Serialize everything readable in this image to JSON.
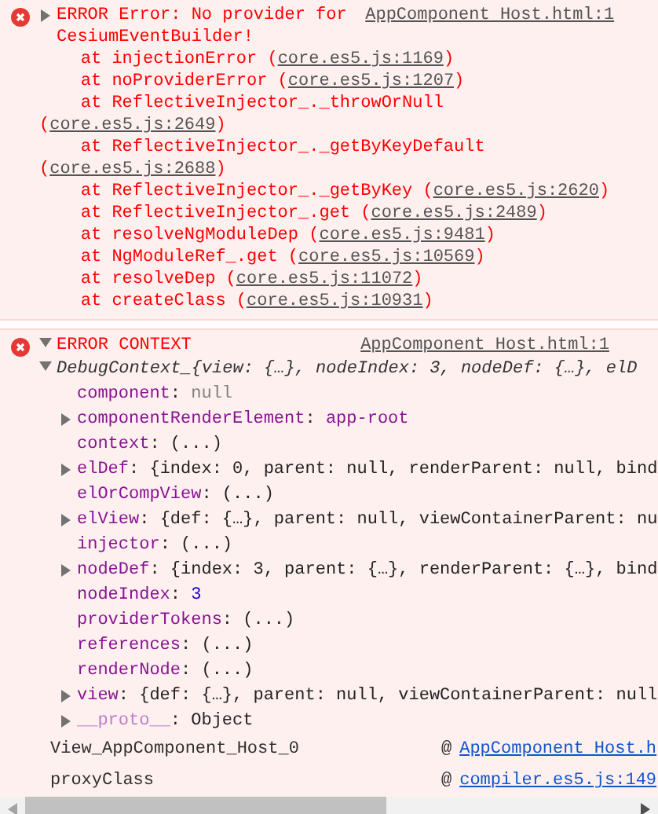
{
  "error_message": {
    "expanded": false,
    "text": "ERROR Error: No provider for CesiumEventBuilder!",
    "source": "AppComponent Host.html:1",
    "frames": [
      {
        "before": "at injectionError (",
        "link": "core.es5.js:1169",
        "after": ")"
      },
      {
        "before": "at noProviderError (",
        "link": "core.es5.js:1207",
        "after": ")"
      },
      {
        "before": "at ReflectiveInjector_._throwOrNull (",
        "link": "core.es5.js:2649",
        "after": ")"
      },
      {
        "before": "at ReflectiveInjector_._getByKeyDefault (",
        "link": "core.es5.js:2688",
        "after": ")"
      },
      {
        "before": "at ReflectiveInjector_._getByKey (",
        "link": "core.es5.js:2620",
        "after": ")"
      },
      {
        "before": "at ReflectiveInjector_.get (",
        "link": "core.es5.js:2489",
        "after": ")"
      },
      {
        "before": "at resolveNgModuleDep (",
        "link": "core.es5.js:9481",
        "after": ")"
      },
      {
        "before": "at NgModuleRef_.get (",
        "link": "core.es5.js:10569",
        "after": ")"
      },
      {
        "before": "at resolveDep (",
        "link": "core.es5.js:11072",
        "after": ")"
      },
      {
        "before": "at createClass (",
        "link": "core.es5.js:10931",
        "after": ")"
      }
    ]
  },
  "error_context": {
    "expanded": true,
    "text": "ERROR CONTEXT",
    "source": "AppComponent Host.html:1",
    "object": {
      "expanded": true,
      "name": "DebugContext_",
      "separator": ":",
      "preview": "{view: {…}, nodeIndex: 3, nodeDef: {…}, elD",
      "properties": [
        {
          "key": "component",
          "value": "null",
          "kind": "null",
          "expandable": false
        },
        {
          "key": "componentRenderElement",
          "value": "app-root",
          "kind": "element",
          "expandable": true
        },
        {
          "key": "context",
          "value": "(...)",
          "kind": "getter",
          "expandable": false
        },
        {
          "key": "elDef",
          "value": "{index: 0, parent: null, renderParent: null, bind",
          "kind": "object",
          "expandable": true
        },
        {
          "key": "elOrCompView",
          "value": "(...)",
          "kind": "getter",
          "expandable": false
        },
        {
          "key": "elView",
          "value": "{def: {…}, parent: null, viewContainerParent: nu",
          "kind": "object",
          "expandable": true
        },
        {
          "key": "injector",
          "value": "(...)",
          "kind": "getter",
          "expandable": false
        },
        {
          "key": "nodeDef",
          "value": "{index: 3, parent: {…}, renderParent: {…}, bind",
          "kind": "object",
          "expandable": true
        },
        {
          "key": "nodeIndex",
          "value": "3",
          "kind": "number",
          "expandable": false
        },
        {
          "key": "providerTokens",
          "value": "(...)",
          "kind": "getter",
          "expandable": false
        },
        {
          "key": "references",
          "value": "(...)",
          "kind": "getter",
          "expandable": false
        },
        {
          "key": "renderNode",
          "value": "(...)",
          "kind": "getter",
          "expandable": false
        },
        {
          "key": "view",
          "value": "{def: {…}, parent: null, viewContainerParent: null",
          "kind": "object",
          "expandable": true
        },
        {
          "key": "__proto__",
          "value": "Object",
          "kind": "proto",
          "expandable": true
        }
      ]
    },
    "call_stack": [
      {
        "function": "View_AppComponent_Host_0",
        "at": "@",
        "link": "AppComponent Host.h"
      },
      {
        "function": "proxyClass",
        "at": "@",
        "link": "compiler.es5.js:149"
      }
    ]
  }
}
